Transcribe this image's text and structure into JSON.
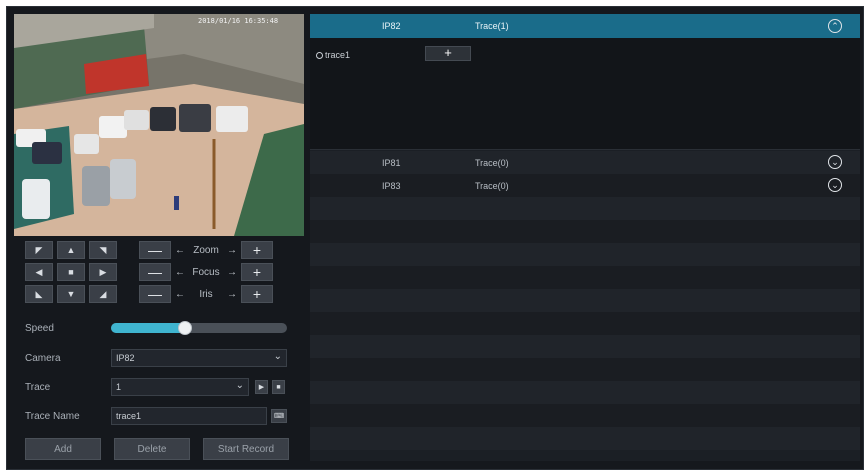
{
  "video": {
    "timestamp": "2018/01/16 16:35:48"
  },
  "ptz": {
    "buttons": [
      {
        "name": "pan-up-left-button",
        "glyph": "◤"
      },
      {
        "name": "pan-up-button",
        "glyph": "▲"
      },
      {
        "name": "pan-up-right-button",
        "glyph": "◥"
      },
      {
        "name": "pan-left-button",
        "glyph": "◀"
      },
      {
        "name": "stop-button",
        "glyph": "■"
      },
      {
        "name": "pan-right-button",
        "glyph": "▶"
      },
      {
        "name": "pan-down-left-button",
        "glyph": "◣"
      },
      {
        "name": "pan-down-button",
        "glyph": "▼"
      },
      {
        "name": "pan-down-right-button",
        "glyph": "◢"
      }
    ],
    "zoom_label": "Zoom",
    "focus_label": "Focus",
    "iris_label": "Iris",
    "minus": "—",
    "plus": "+",
    "left_arrow": "←",
    "right_arrow": "→"
  },
  "form": {
    "speed_label": "Speed",
    "speed_fraction": 0.42,
    "camera_label": "Camera",
    "camera_value": "IP82",
    "trace_label": "Trace",
    "trace_value": "1",
    "trace_name_label": "Trace Name",
    "trace_name_value": "trace1",
    "chevron": "⌄",
    "play_glyph": "▶",
    "stop_glyph": "■",
    "keyboard_glyph": "⌨"
  },
  "actions": {
    "add": "Add",
    "delete": "Delete",
    "start_record": "Start Record"
  },
  "list": {
    "expanded": {
      "camera": "IP82",
      "trace": "Trace(1)",
      "toggle": "⌃",
      "item_label": "trace1",
      "add_glyph": "+"
    },
    "rows": [
      {
        "camera": "IP81",
        "trace": "Trace(0)",
        "toggle": "⌄"
      },
      {
        "camera": "IP83",
        "trace": "Trace(0)",
        "toggle": "⌄"
      }
    ]
  },
  "colors": {
    "header_bg": "#1a6c8a",
    "accent": "#3fb4cf",
    "panel_bg": "#15181d"
  }
}
